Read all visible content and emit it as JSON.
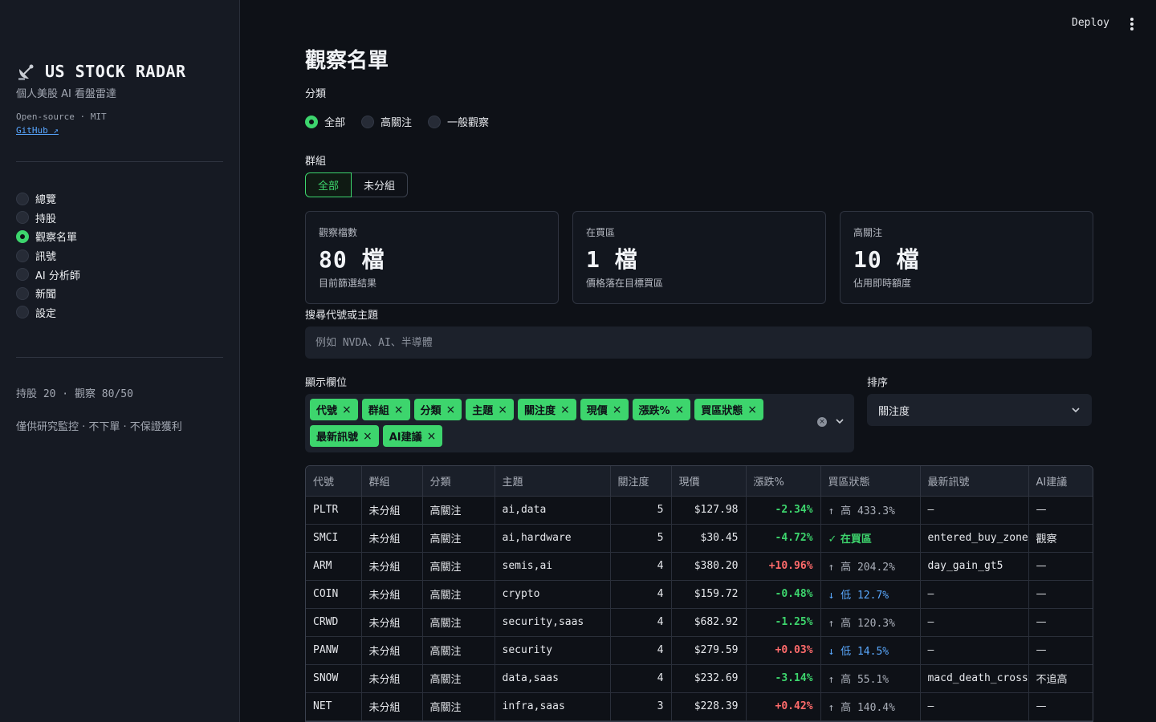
{
  "sidebar": {
    "title": "US STOCK RADAR",
    "subtitle": "個人美股 AI 看盤雷達",
    "license": "Open-source · MIT",
    "github": "GitHub ↗",
    "nav": [
      {
        "label": "總覽",
        "active": false
      },
      {
        "label": "持股",
        "active": false
      },
      {
        "label": "觀察名單",
        "active": true
      },
      {
        "label": "訊號",
        "active": false
      },
      {
        "label": "AI 分析師",
        "active": false
      },
      {
        "label": "新聞",
        "active": false
      },
      {
        "label": "設定",
        "active": false
      }
    ],
    "stats": "持股 20 · 觀察 80/50",
    "note": "僅供研究監控 · 不下單 · 不保證獲利"
  },
  "header": {
    "deploy": "Deploy"
  },
  "main": {
    "title": "觀察名單",
    "category_label": "分類",
    "category_options": [
      {
        "label": "全部",
        "selected": true
      },
      {
        "label": "高關注",
        "selected": false
      },
      {
        "label": "一般觀察",
        "selected": false
      }
    ],
    "group_label": "群組",
    "group_options": [
      {
        "label": "全部",
        "active": true
      },
      {
        "label": "未分組",
        "active": false
      }
    ],
    "cards": [
      {
        "label": "觀察檔數",
        "value": "80 檔",
        "sub": "目前篩選結果"
      },
      {
        "label": "在買區",
        "value": "1 檔",
        "sub": "價格落在目標買區"
      },
      {
        "label": "高關注",
        "value": "10 檔",
        "sub": "佔用即時額度"
      }
    ],
    "search_label": "搜尋代號或主題",
    "search_placeholder": "例如 NVDA、AI、半導體",
    "columns_label": "顯示欄位",
    "chips": [
      "代號",
      "群組",
      "分類",
      "主題",
      "關注度",
      "現價",
      "漲跌%",
      "買區狀態",
      "最新訊號",
      "AI建議"
    ],
    "sort_label": "排序",
    "sort_value": "關注度",
    "table": {
      "headers": [
        "代號",
        "群組",
        "分類",
        "主題",
        "關注度",
        "現價",
        "漲跌%",
        "買區狀態",
        "最新訊號",
        "AI建議"
      ],
      "rows": [
        {
          "ticker": "PLTR",
          "group": "未分組",
          "category": "高關注",
          "theme": "ai,data",
          "attention": "5",
          "price": "$127.98",
          "change": "-2.34%",
          "zone": "↑ 高 433.3%",
          "zone_type": "high",
          "signal": "—",
          "ai": "—"
        },
        {
          "ticker": "SMCI",
          "group": "未分組",
          "category": "高關注",
          "theme": "ai,hardware",
          "attention": "5",
          "price": "$30.45",
          "change": "-4.72%",
          "zone": "✓ 在買區",
          "zone_type": "in",
          "signal": "entered_buy_zone",
          "ai": "觀察"
        },
        {
          "ticker": "ARM",
          "group": "未分組",
          "category": "高關注",
          "theme": "semis,ai",
          "attention": "4",
          "price": "$380.20",
          "change": "+10.96%",
          "zone": "↑ 高 204.2%",
          "zone_type": "high",
          "signal": "day_gain_gt5",
          "ai": "—"
        },
        {
          "ticker": "COIN",
          "group": "未分組",
          "category": "高關注",
          "theme": "crypto",
          "attention": "4",
          "price": "$159.72",
          "change": "-0.48%",
          "zone": "↓ 低 12.7%",
          "zone_type": "low",
          "signal": "—",
          "ai": "—"
        },
        {
          "ticker": "CRWD",
          "group": "未分組",
          "category": "高關注",
          "theme": "security,saas",
          "attention": "4",
          "price": "$682.92",
          "change": "-1.25%",
          "zone": "↑ 高 120.3%",
          "zone_type": "high",
          "signal": "—",
          "ai": "—"
        },
        {
          "ticker": "PANW",
          "group": "未分組",
          "category": "高關注",
          "theme": "security",
          "attention": "4",
          "price": "$279.59",
          "change": "+0.03%",
          "zone": "↓ 低 14.5%",
          "zone_type": "low",
          "signal": "—",
          "ai": "—"
        },
        {
          "ticker": "SNOW",
          "group": "未分組",
          "category": "高關注",
          "theme": "data,saas",
          "attention": "4",
          "price": "$232.69",
          "change": "-3.14%",
          "zone": "↑ 高 55.1%",
          "zone_type": "high",
          "signal": "macd_death_cross",
          "ai": "不追高"
        },
        {
          "ticker": "NET",
          "group": "未分組",
          "category": "高關注",
          "theme": "infra,saas",
          "attention": "3",
          "price": "$228.39",
          "change": "+0.42%",
          "zone": "↑ 高 140.4%",
          "zone_type": "high",
          "signal": "—",
          "ai": "—"
        }
      ]
    }
  },
  "colors": {
    "accent": "#3dd56d",
    "negative": "#ff6b6b",
    "low_zone": "#5aa9ff",
    "background": "#0e1117",
    "sidebar": "#161a23"
  },
  "icons": {
    "brand": "satellite-dish-icon",
    "more": "kebab-menu-icon",
    "clear": "clear-icon",
    "caret": "chevron-down-icon",
    "chip_remove": "close-icon"
  }
}
